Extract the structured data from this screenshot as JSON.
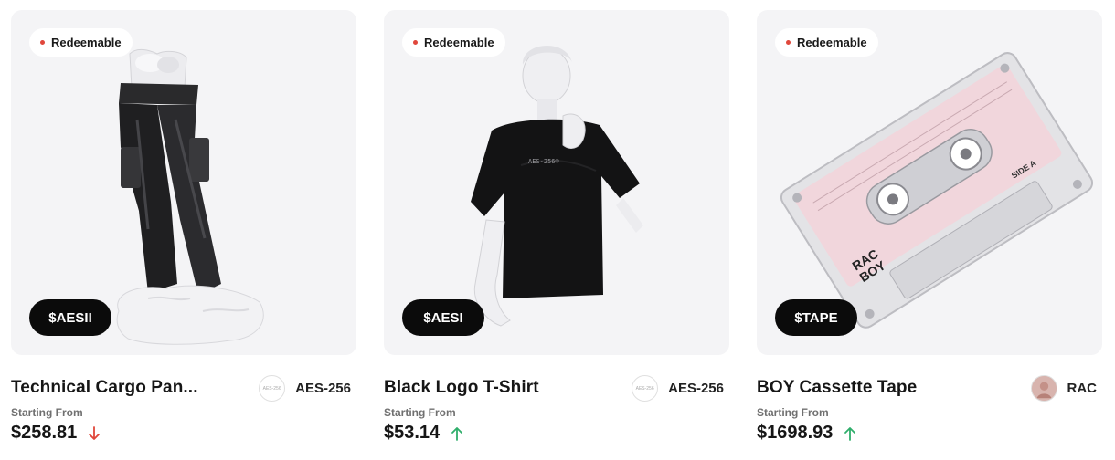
{
  "cards": [
    {
      "badge": "Redeemable",
      "ticker": "$AESII",
      "title": "Technical Cargo Pan...",
      "creator": {
        "name": "AES-256",
        "avatar_text": "AES-256"
      },
      "price_label": "Starting From",
      "price": "$258.81",
      "trend": "down",
      "trend_icon": "arrow-down-icon"
    },
    {
      "badge": "Redeemable",
      "ticker": "$AESI",
      "title": "Black Logo T-Shirt",
      "creator": {
        "name": "AES-256",
        "avatar_text": "AES-256"
      },
      "price_label": "Starting From",
      "price": "$53.14",
      "trend": "up",
      "trend_icon": "arrow-up-icon"
    },
    {
      "badge": "Redeemable",
      "ticker": "$TAPE",
      "title": "BOY Cassette Tape",
      "creator": {
        "name": "RAC",
        "avatar_text": ""
      },
      "price_label": "Starting From",
      "price": "$1698.93",
      "trend": "up",
      "trend_icon": "arrow-up-icon"
    }
  ],
  "colors": {
    "badge_dot": "#e0473b",
    "trend_down": "#e0473b",
    "trend_up": "#2fae6b",
    "ticker_bg": "#0b0b0b",
    "card_bg": "#f4f4f6"
  },
  "art": {
    "tshirt_print": "AES-256®",
    "tape_label_lines": [
      "RAC",
      "BOY"
    ],
    "tape_side": "SIDE A",
    "tape_ticker": "$TAPE"
  }
}
